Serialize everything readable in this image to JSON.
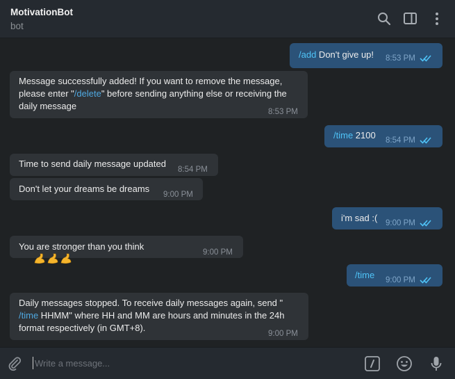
{
  "header": {
    "title": "MotivationBot",
    "subtitle": "bot"
  },
  "messages": [
    {
      "dir": "out",
      "cmd": "/add",
      "text": " Don't give up!",
      "time": "8:53 PM"
    },
    {
      "dir": "in",
      "line1": "Message successfully added! If you want to remove the message,",
      "line2_pre": "please enter \"",
      "line2_cmd": "/delete",
      "line2_post": "\" before sending anything else or receiving the",
      "line3": "daily message",
      "time": "8:53 PM"
    },
    {
      "dir": "out",
      "cmd": "/time",
      "text": " 2100",
      "time": "8:54 PM"
    },
    {
      "dir": "in",
      "text": "Time to send daily message updated",
      "time": "8:54 PM"
    },
    {
      "dir": "in",
      "text": "Don't let your dreams be dreams",
      "time": "9:00 PM"
    },
    {
      "dir": "out",
      "text": "i'm sad :(",
      "time": "9:00 PM"
    },
    {
      "dir": "in",
      "text": "You are stronger than you think",
      "emoji": "💪💪💪",
      "time": "9:00 PM"
    },
    {
      "dir": "out",
      "cmd": "/time",
      "text": "",
      "time": "9:00 PM"
    },
    {
      "dir": "in",
      "line1": "Daily messages stopped. To receive daily messages again, send \"",
      "line2_cmd": "/time",
      "line2_post": " HHMM\" where HH and MM are hours and minutes in the 24h",
      "line3": "format respectively (in GMT+8).",
      "time": "9:00 PM"
    }
  ],
  "input": {
    "placeholder": "Write a message..."
  },
  "colors": {
    "background": "#1f2224",
    "incoming_bubble": "#2f3337",
    "outgoing_bubble": "#2b5278",
    "accent": "#4fc3f7"
  },
  "icons": [
    "search-icon",
    "sidebar-toggle-icon",
    "more-vertical-icon",
    "attach-icon",
    "commands-icon",
    "emoji-icon",
    "microphone-icon",
    "double-check-icon"
  ]
}
